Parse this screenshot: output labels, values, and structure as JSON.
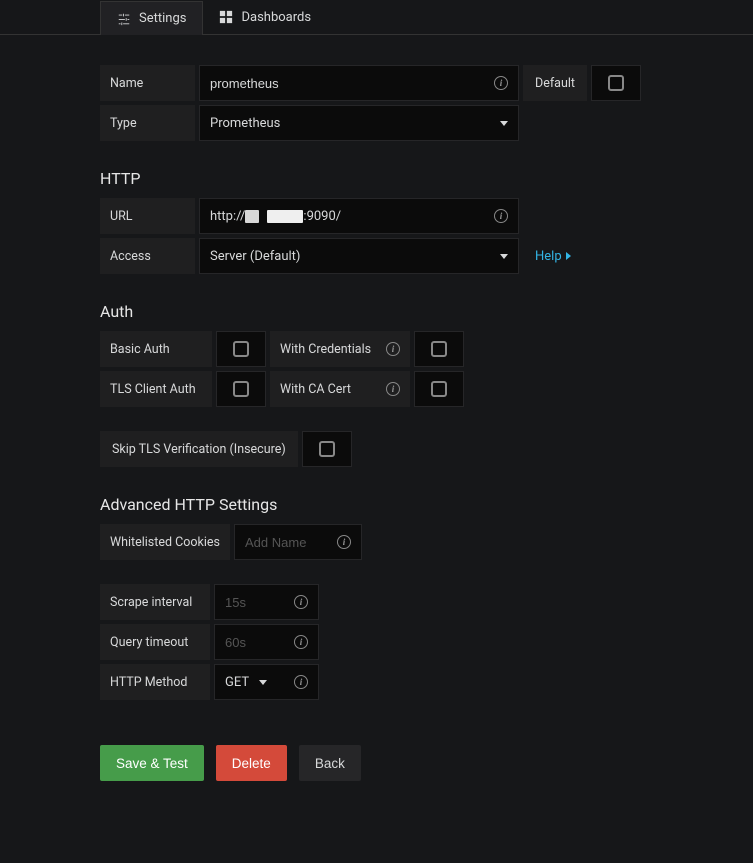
{
  "tabs": {
    "settings": "Settings",
    "dashboards": "Dashboards"
  },
  "basic": {
    "name_label": "Name",
    "name_value": "prometheus",
    "type_label": "Type",
    "type_value": "Prometheus",
    "default_label": "Default"
  },
  "http": {
    "section": "HTTP",
    "url_label": "URL",
    "url_prefix": "http://",
    "url_suffix": ":9090/",
    "access_label": "Access",
    "access_value": "Server (Default)",
    "help_label": "Help"
  },
  "auth": {
    "section": "Auth",
    "basic_auth": "Basic Auth",
    "with_credentials": "With Credentials",
    "tls_client_auth": "TLS Client Auth",
    "with_ca_cert": "With CA Cert",
    "skip_tls": "Skip TLS Verification (Insecure)"
  },
  "advanced": {
    "section": "Advanced HTTP Settings",
    "whitelisted_cookies": "Whitelisted Cookies",
    "add_name_placeholder": "Add Name",
    "scrape_interval_label": "Scrape interval",
    "scrape_interval_placeholder": "15s",
    "query_timeout_label": "Query timeout",
    "query_timeout_placeholder": "60s",
    "http_method_label": "HTTP Method",
    "http_method_value": "GET"
  },
  "buttons": {
    "save_test": "Save & Test",
    "delete": "Delete",
    "back": "Back"
  }
}
